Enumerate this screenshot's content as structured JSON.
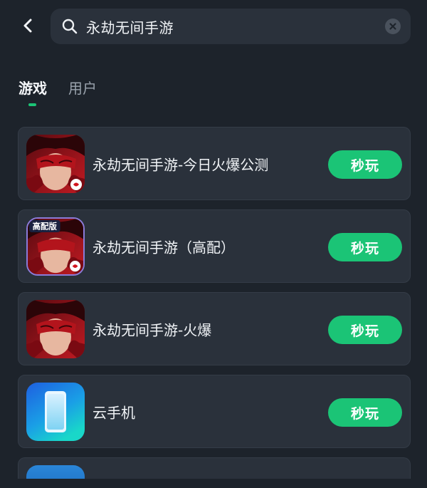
{
  "search": {
    "query": "永劫无间手游"
  },
  "tabs": [
    {
      "label": "游戏",
      "active": true
    },
    {
      "label": "用户",
      "active": false
    }
  ],
  "colors": {
    "accent": "#1bc476",
    "background": "#1d232b",
    "card": "#2a313b",
    "text": "#f0f3f6",
    "muted": "#9aa3ad"
  },
  "results": [
    {
      "name": "永劫无间手游-今日火爆公测",
      "action": "秒玩",
      "icon": "game-icon-mask"
    },
    {
      "name": "永劫无间手游（高配）",
      "action": "秒玩",
      "icon": "game-icon-mask",
      "icon_badge": "高配版"
    },
    {
      "name": "永劫无间手游-火爆",
      "action": "秒玩",
      "icon": "game-icon-mask"
    },
    {
      "name": "云手机",
      "action": "秒玩",
      "icon": "phone-icon"
    }
  ]
}
